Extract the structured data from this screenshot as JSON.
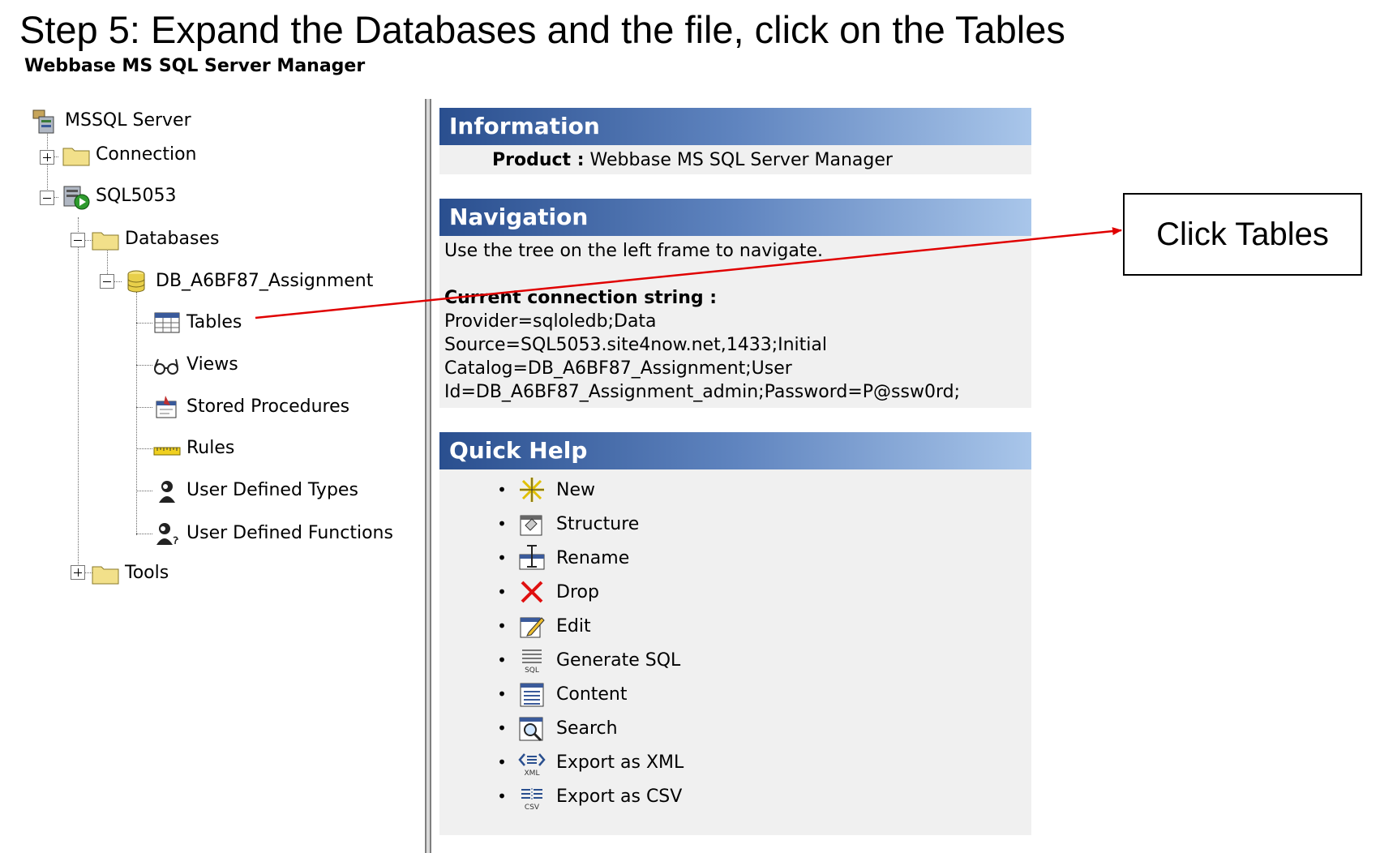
{
  "step_title": "Step 5: Expand the Databases and the file, click on the Tables",
  "app_title": "Webbase MS SQL Server Manager",
  "tree": {
    "server": "MSSQL Server",
    "connection": "Connection",
    "instance": "SQL5053",
    "databases": "Databases",
    "database_file": "DB_A6BF87_Assignment",
    "tables": "Tables",
    "views": "Views",
    "stored_procedures": "Stored Procedures",
    "rules": "Rules",
    "user_defined_types": "User Defined Types",
    "user_defined_functions": "User Defined Functions",
    "tools": "Tools"
  },
  "information": {
    "title": "Information",
    "product_label": "Product :",
    "product_value": "Webbase MS SQL Server Manager"
  },
  "navigation": {
    "title": "Navigation",
    "text": "Use the tree on the left frame to navigate.",
    "conn_label": "Current connection string :",
    "conn_lines": [
      "Provider=sqloledb;Data",
      "Source=SQL5053.site4now.net,1433;Initial",
      "Catalog=DB_A6BF87_Assignment;User",
      "Id=DB_A6BF87_Assignment_admin;Password=P@ssw0rd;"
    ]
  },
  "quick_help": {
    "title": "Quick Help",
    "bullet": "•",
    "items": [
      {
        "label": "New",
        "icon": "new-star-icon"
      },
      {
        "label": "Structure",
        "icon": "structure-icon"
      },
      {
        "label": "Rename",
        "icon": "rename-icon"
      },
      {
        "label": "Drop",
        "icon": "drop-x-icon"
      },
      {
        "label": "Edit",
        "icon": "edit-icon"
      },
      {
        "label": "Generate SQL",
        "icon": "generate-sql-icon"
      },
      {
        "label": "Content",
        "icon": "content-icon"
      },
      {
        "label": "Search",
        "icon": "search-icon"
      },
      {
        "label": "Export as XML",
        "icon": "export-xml-icon"
      },
      {
        "label": "Export as CSV",
        "icon": "export-csv-icon"
      }
    ],
    "icon_text": {
      "sql": "SQL",
      "xml": "XML",
      "csv": "CSV"
    }
  },
  "callout": {
    "text": "Click Tables"
  },
  "colors": {
    "annotation": "#e00000",
    "header_dark": "#2a4f8f",
    "header_light": "#a9c6ea",
    "panel_bg": "#f0f0f0"
  }
}
